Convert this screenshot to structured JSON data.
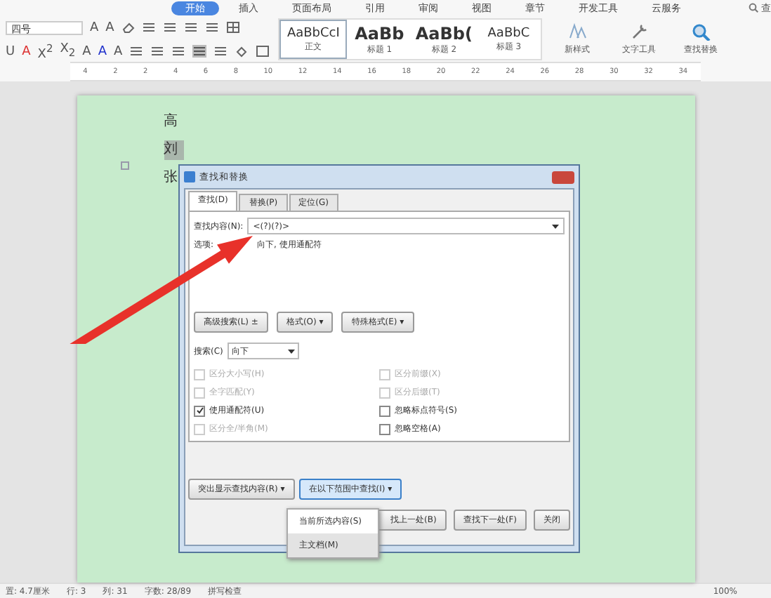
{
  "ribbon": {
    "tabs": [
      {
        "label": "开始",
        "selected": true
      },
      {
        "label": "插入",
        "selected": false
      },
      {
        "label": "页面布局",
        "selected": false
      },
      {
        "label": "引用",
        "selected": false
      },
      {
        "label": "审阅",
        "selected": false
      },
      {
        "label": "视图",
        "selected": false
      },
      {
        "label": "章节",
        "selected": false
      },
      {
        "label": "开发工具",
        "selected": false
      },
      {
        "label": "云服务",
        "selected": false
      }
    ],
    "search_label": "查",
    "font_size": "四号",
    "glyphs_row1": [
      "A",
      "A"
    ],
    "glyphs_row2": [
      "U",
      "A",
      "X$^{2}$",
      "X$_{2}$",
      "A",
      "A",
      "A"
    ],
    "styles": [
      {
        "preview": "AaBbCcI",
        "name": "正文"
      },
      {
        "preview": "AaBb",
        "name": "标题 1"
      },
      {
        "preview": "AaBb(",
        "name": "标题 2"
      },
      {
        "preview": "AaBbC",
        "name": "标题 3"
      }
    ],
    "tools": [
      {
        "label": "新样式"
      },
      {
        "label": "文字工具"
      },
      {
        "label": "查找替换"
      }
    ]
  },
  "ruler": {
    "labels": [
      "4",
      "2",
      "2",
      "4",
      "6",
      "8",
      "10",
      "12",
      "14",
      "16",
      "18",
      "20",
      "22",
      "24",
      "26",
      "28",
      "30",
      "32",
      "34"
    ]
  },
  "document": {
    "lines": [
      {
        "text": "高",
        "highlighted": false
      },
      {
        "text": "刘",
        "highlighted": true
      },
      {
        "text": "张",
        "highlighted": false
      }
    ]
  },
  "dialog": {
    "title": "查找和替换",
    "tabs": [
      {
        "label": "查找(D)",
        "selected": true
      },
      {
        "label": "替换(P)",
        "selected": false
      },
      {
        "label": "定位(G)",
        "selected": false
      }
    ],
    "find_label": "查找内容(N):",
    "find_value": "<(?)(?)>",
    "options_label": "选项:",
    "options_value": "向下, 使用通配符",
    "format_buttons": [
      {
        "label": "高级搜索(L) ±"
      },
      {
        "label": "格式(O) ▾"
      },
      {
        "label": "特殊格式(E) ▾"
      }
    ],
    "search_label": "搜索(C)",
    "search_value": "向下",
    "checkboxes": [
      {
        "label": "区分大小写(H)",
        "checked": false,
        "disabled": true
      },
      {
        "label": "区分前缀(X)",
        "checked": false,
        "disabled": true
      },
      {
        "label": "全字匹配(Y)",
        "checked": false,
        "disabled": true
      },
      {
        "label": "区分后缀(T)",
        "checked": false,
        "disabled": true
      },
      {
        "label": "使用通配符(U)",
        "checked": true,
        "disabled": false
      },
      {
        "label": "忽略标点符号(S)",
        "checked": false,
        "disabled": false
      },
      {
        "label": "区分全/半角(M)",
        "checked": false,
        "disabled": true
      },
      {
        "label": "忽略空格(A)",
        "checked": false,
        "disabled": false
      }
    ],
    "menu_buttons": [
      {
        "label": "突出显示查找内容(R) ▾",
        "selected": false
      },
      {
        "label": "在以下范围中查找(I) ▾",
        "selected": true
      }
    ],
    "action_buttons": [
      {
        "label": "找上一处(B)"
      },
      {
        "label": "查找下一处(F)"
      },
      {
        "label": "关闭"
      }
    ],
    "menu": [
      {
        "label": "当前所选内容(S)",
        "selected": false
      },
      {
        "label": "主文档(M)",
        "selected": true
      }
    ]
  },
  "status_bar": {
    "items": [
      "置: 4.7厘米",
      "行: 3",
      "列: 31",
      "字数: 28/89",
      "拼写检查"
    ],
    "zoom": "100%"
  }
}
